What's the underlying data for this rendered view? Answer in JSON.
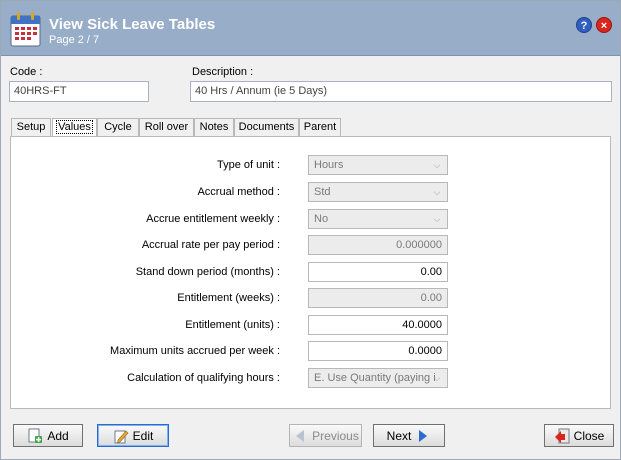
{
  "window": {
    "title": "View Sick Leave Tables",
    "subtitle": "Page 2 / 7",
    "help_symbol": "?",
    "close_symbol": "×"
  },
  "header": {
    "code_label": "Code :",
    "code_value": "40HRS-FT",
    "description_label": "Description :",
    "description_value": "40 Hrs / Annum (ie 5 Days)"
  },
  "tabs": [
    {
      "label": "Setup"
    },
    {
      "label": "Values",
      "active": true
    },
    {
      "label": "Cycle"
    },
    {
      "label": "Roll over"
    },
    {
      "label": "Notes"
    },
    {
      "label": "Documents"
    },
    {
      "label": "Parent"
    }
  ],
  "fields": {
    "type_of_unit": {
      "label": "Type of unit :",
      "value": "Hours"
    },
    "accrual_method": {
      "label": "Accrual method :",
      "value": "Std"
    },
    "accrue_weekly": {
      "label": "Accrue entitlement weekly :",
      "value": "No"
    },
    "accrual_rate": {
      "label": "Accrual rate per pay period :",
      "value": "0.000000"
    },
    "stand_down": {
      "label": "Stand down period (months) :",
      "value": "0.00"
    },
    "entitlement_weeks": {
      "label": "Entitlement (weeks) :",
      "value": "0.00"
    },
    "entitlement_units": {
      "label": "Entitlement (units) :",
      "value": "40.0000"
    },
    "max_units_week": {
      "label": "Maximum units accrued per week :",
      "value": "0.0000"
    },
    "qualifying_hours": {
      "label": "Calculation of qualifying hours :",
      "value": "E. Use Quantity (paying i"
    }
  },
  "buttons": {
    "add": "Add",
    "edit": "Edit",
    "previous": "Previous",
    "next": "Next",
    "close": "Close"
  },
  "icons": {
    "app": "calendar-icon",
    "add": "add-document-icon",
    "edit": "edit-pencil-icon",
    "previous": "arrow-left-icon",
    "next": "arrow-right-icon",
    "close": "exit-icon"
  },
  "colors": {
    "titlebar": "#98adc8",
    "accent_blue": "#2b6cd0",
    "close_red": "#d9261c"
  }
}
